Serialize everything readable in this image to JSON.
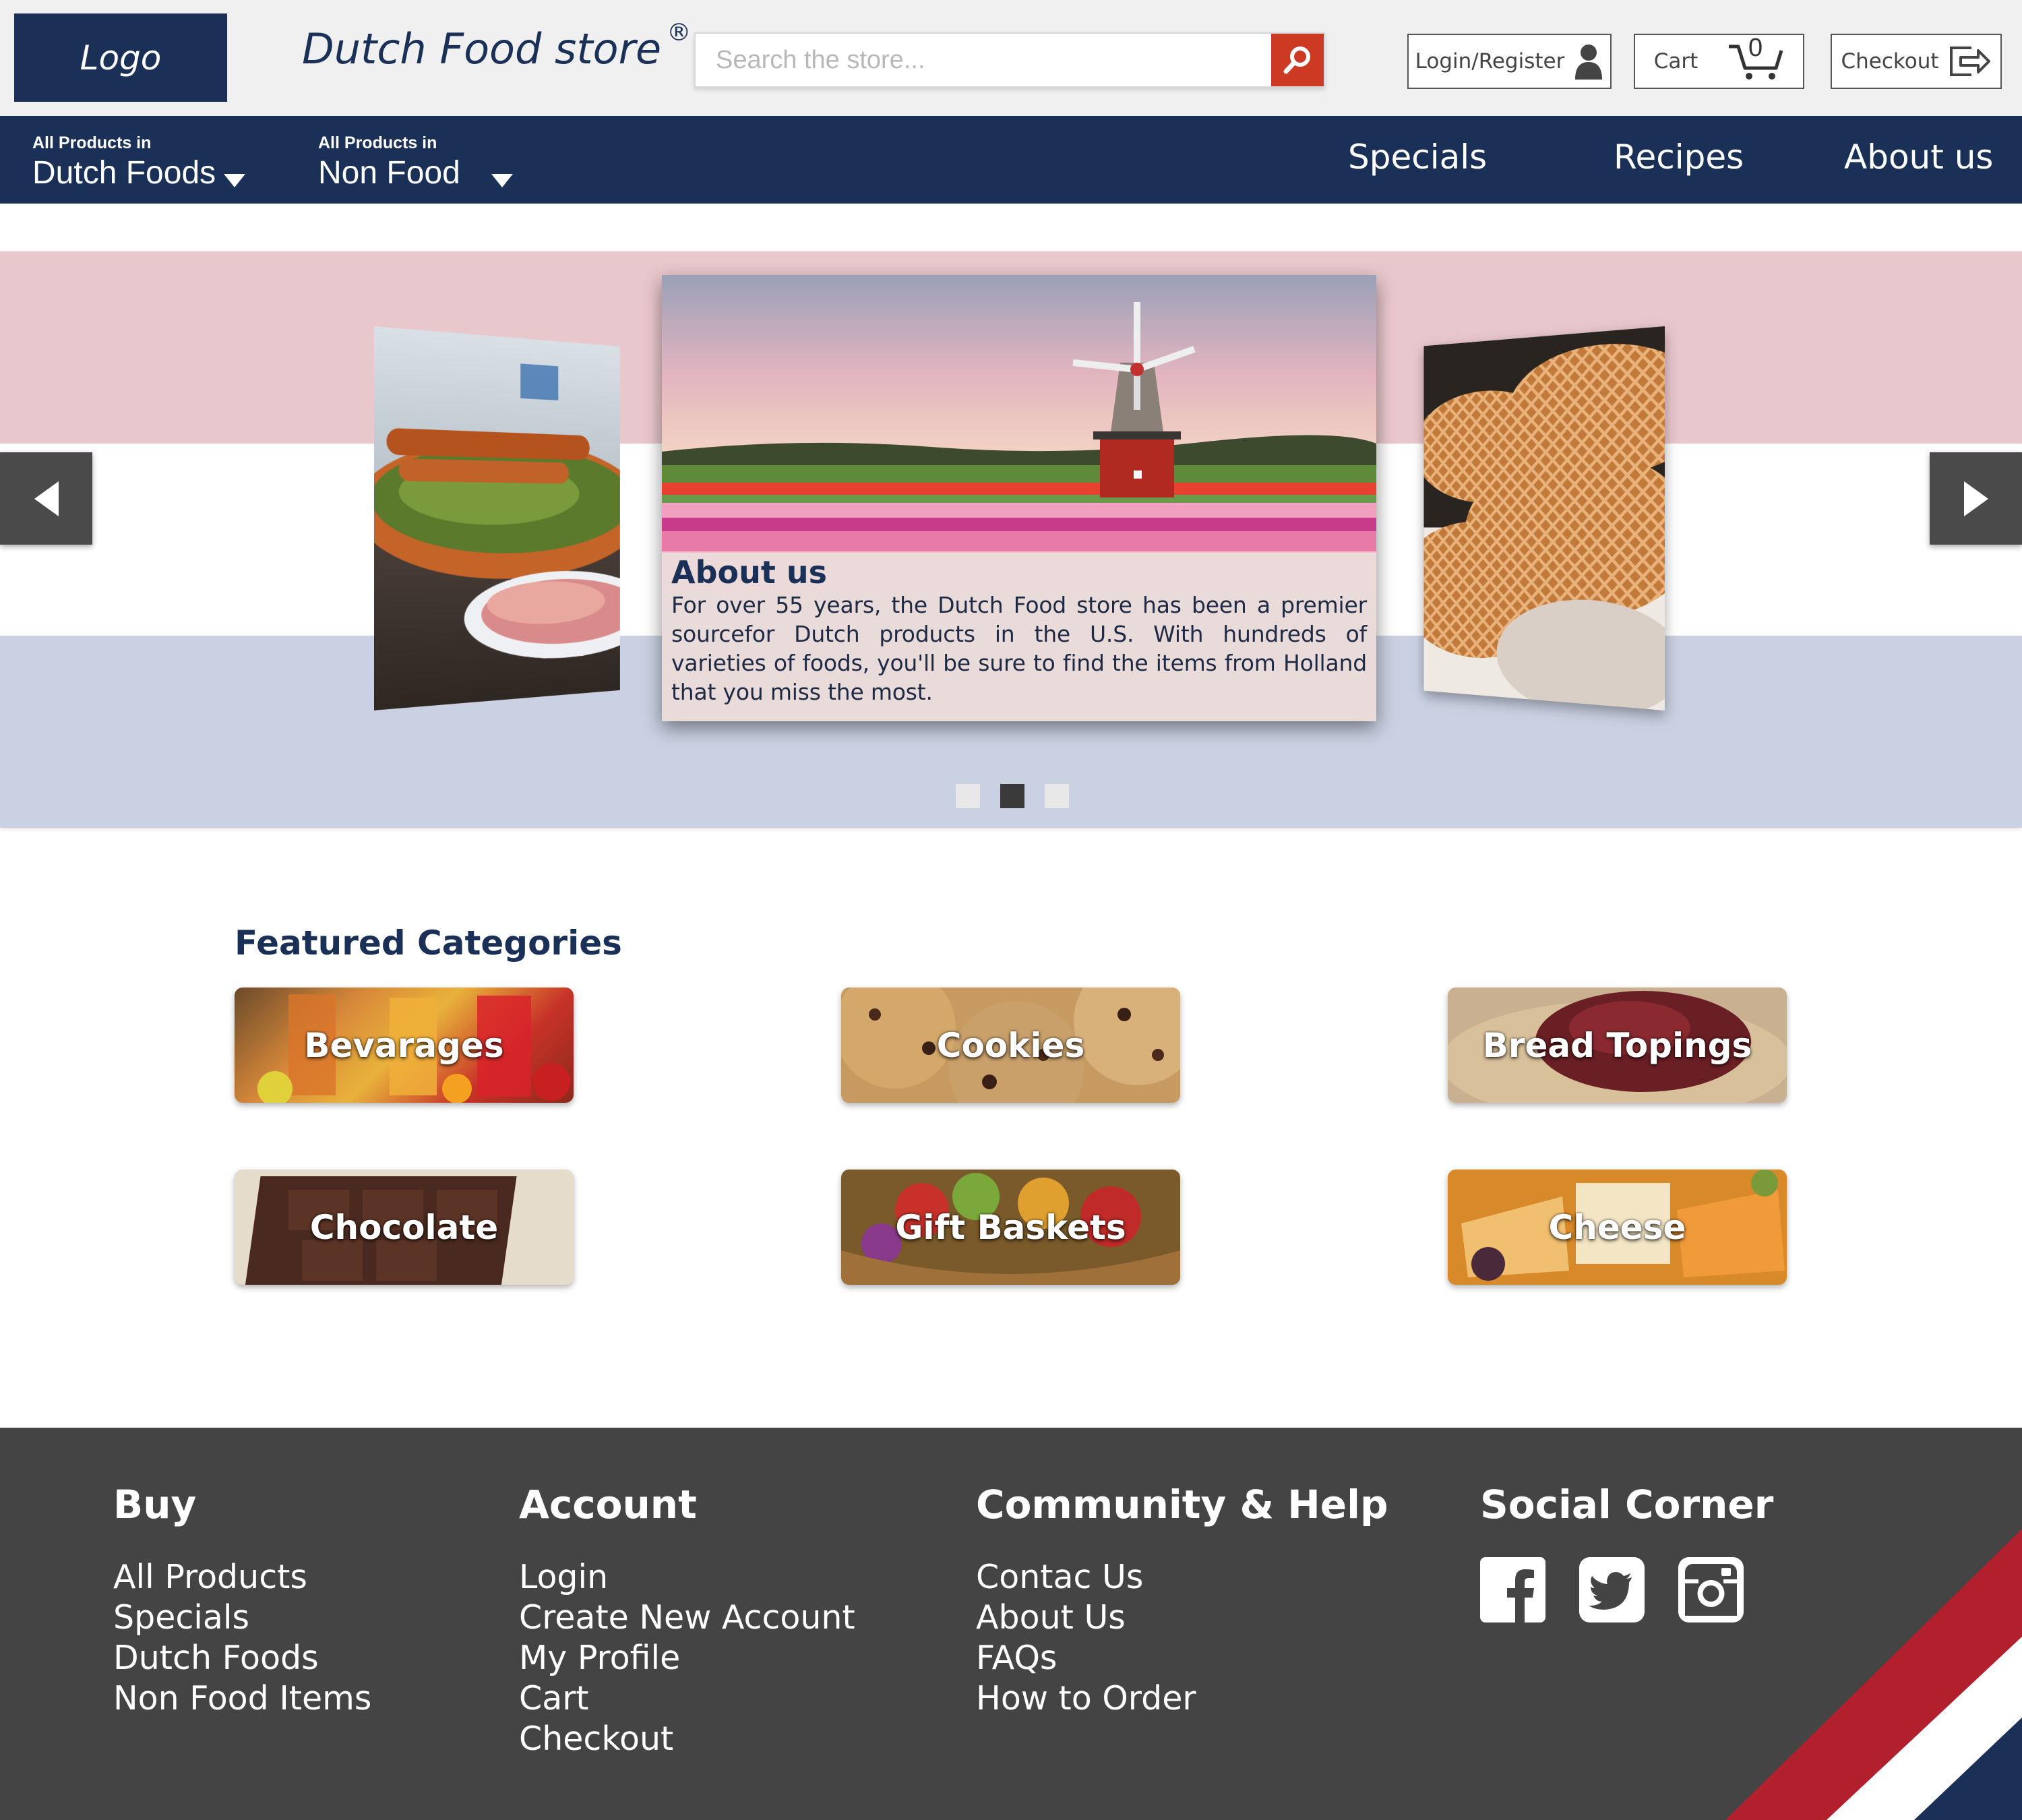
{
  "header": {
    "logo_text": "Logo",
    "brand_name": "Dutch Food store",
    "brand_mark": "®",
    "search_placeholder": "Search the store...",
    "login_label": "Login/Register",
    "cart_label": "Cart",
    "cart_count": "0",
    "checkout_label": "Checkout",
    "icons": [
      "search-icon",
      "user-icon",
      "cart-icon",
      "checkout-icon"
    ]
  },
  "nav": {
    "dutch_small": "All Products in",
    "dutch_big": "Dutch Foods",
    "nonfood_small": "All Products in",
    "nonfood_big": "Non Food",
    "links": [
      "Specials",
      "Recipes",
      "About us"
    ]
  },
  "hero": {
    "slide_title": "About us",
    "slide_text": "For over 55 years, the Dutch Food store has been a premier sourcefor Dutch products in the U.S. With hundreds of varieties of foods, you'll be sure to find the items from Holland that you miss the most.",
    "active_dot": 2,
    "dot_count": 3
  },
  "featured": {
    "title": "Featured Categories",
    "categories": [
      "Bevarages",
      "Cookies",
      "Bread Topings",
      "Chocolate",
      "Gift Baskets",
      "Cheese"
    ]
  },
  "footer": {
    "buy": {
      "title": "Buy",
      "links": [
        "All Products",
        "Specials",
        "Dutch Foods",
        "Non Food Items"
      ]
    },
    "account": {
      "title": "Account",
      "links": [
        "Login",
        "Create New Account",
        "My Profile",
        "Cart",
        "Checkout"
      ]
    },
    "help": {
      "title": "Community & Help",
      "links": [
        "Contac Us",
        "About Us",
        "FAQs",
        "How to Order"
      ]
    },
    "social": {
      "title": "Social Corner",
      "icons": [
        "facebook-icon",
        "twitter-icon",
        "instagram-icon"
      ]
    }
  },
  "colors": {
    "navy": "#1a3056",
    "search_red": "#cc3a24",
    "stripe_red": "#e9c8cd",
    "stripe_blue": "#c9d1e2",
    "footer_gray": "#444444",
    "flag_red": "#b21f2d",
    "flag_blue": "#1a3056"
  }
}
